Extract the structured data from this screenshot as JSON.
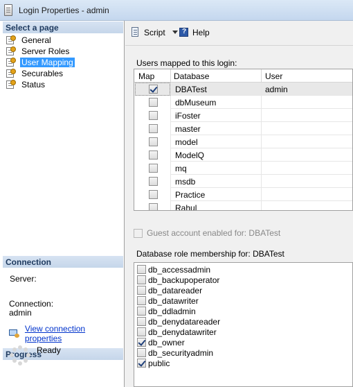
{
  "window": {
    "title": "Login Properties - admin"
  },
  "left_panel": {
    "select_page_header": "Select a page",
    "pages": [
      {
        "label": "General",
        "icon": "page-wrench-icon",
        "selected": false
      },
      {
        "label": "Server Roles",
        "icon": "page-wrench-icon",
        "selected": false
      },
      {
        "label": "User Mapping",
        "icon": "page-wrench-icon",
        "selected": true
      },
      {
        "label": "Securables",
        "icon": "page-wrench-icon",
        "selected": false
      },
      {
        "label": "Status",
        "icon": "page-wrench-icon",
        "selected": false
      }
    ],
    "connection_header": "Connection",
    "server_label": "Server:",
    "server_value": "",
    "connection_label": "Connection:",
    "connection_value": "admin",
    "view_connection_link": "View connection properties",
    "progress_header": "Progress",
    "progress_status": "Ready"
  },
  "toolbar": {
    "script_label": "Script",
    "help_label": "Help"
  },
  "user_mapping": {
    "caption": "Users mapped to this login:",
    "columns": [
      "Map",
      "Database",
      "User"
    ],
    "rows": [
      {
        "mapped": true,
        "database": "DBATest",
        "user": "admin",
        "selected": true
      },
      {
        "mapped": false,
        "database": "dbMuseum",
        "user": ""
      },
      {
        "mapped": false,
        "database": "iFoster",
        "user": ""
      },
      {
        "mapped": false,
        "database": "master",
        "user": ""
      },
      {
        "mapped": false,
        "database": "model",
        "user": ""
      },
      {
        "mapped": false,
        "database": "ModelQ",
        "user": ""
      },
      {
        "mapped": false,
        "database": "mq",
        "user": ""
      },
      {
        "mapped": false,
        "database": "msdb",
        "user": ""
      },
      {
        "mapped": false,
        "database": "Practice",
        "user": ""
      },
      {
        "mapped": false,
        "database": "Rahul",
        "user": ""
      }
    ],
    "guest_label": "Guest account enabled for: DBATest",
    "guest_checked": false,
    "role_caption": "Database role membership for: DBATest",
    "roles": [
      {
        "name": "db_accessadmin",
        "checked": false
      },
      {
        "name": "db_backupoperator",
        "checked": false
      },
      {
        "name": "db_datareader",
        "checked": false
      },
      {
        "name": "db_datawriter",
        "checked": false
      },
      {
        "name": "db_ddladmin",
        "checked": false
      },
      {
        "name": "db_denydatareader",
        "checked": false
      },
      {
        "name": "db_denydatawriter",
        "checked": false
      },
      {
        "name": "db_owner",
        "checked": true
      },
      {
        "name": "db_securityadmin",
        "checked": false
      },
      {
        "name": "public",
        "checked": true
      }
    ]
  }
}
